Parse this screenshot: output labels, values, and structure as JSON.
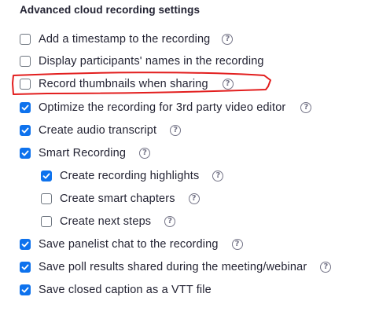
{
  "section_title": "Advanced cloud recording settings",
  "help_glyph": "?",
  "accent_color": "#0e72ed",
  "annotation_color": "#e21e1e",
  "options": [
    {
      "label": "Add a timestamp to the recording",
      "checked": false,
      "help": true
    },
    {
      "label": "Display participants' names in the recording",
      "checked": false,
      "help": false
    },
    {
      "label": "Record thumbnails when sharing",
      "checked": false,
      "help": true,
      "annotated": true
    },
    {
      "label": "Optimize the recording for 3rd party video editor",
      "checked": true,
      "help": true
    },
    {
      "label": "Create audio transcript",
      "checked": true,
      "help": true
    },
    {
      "label": "Smart Recording",
      "checked": true,
      "help": true
    },
    {
      "label": "Create recording highlights",
      "checked": true,
      "help": true,
      "indent": true
    },
    {
      "label": "Create smart chapters",
      "checked": false,
      "help": true,
      "indent": true
    },
    {
      "label": "Create next steps",
      "checked": false,
      "help": true,
      "indent": true
    },
    {
      "label": "Save panelist chat to the recording",
      "checked": true,
      "help": true
    },
    {
      "label": "Save poll results shared during the meeting/webinar",
      "checked": true,
      "help": true
    },
    {
      "label": "Save closed caption as a VTT file",
      "checked": true,
      "help": false
    }
  ]
}
